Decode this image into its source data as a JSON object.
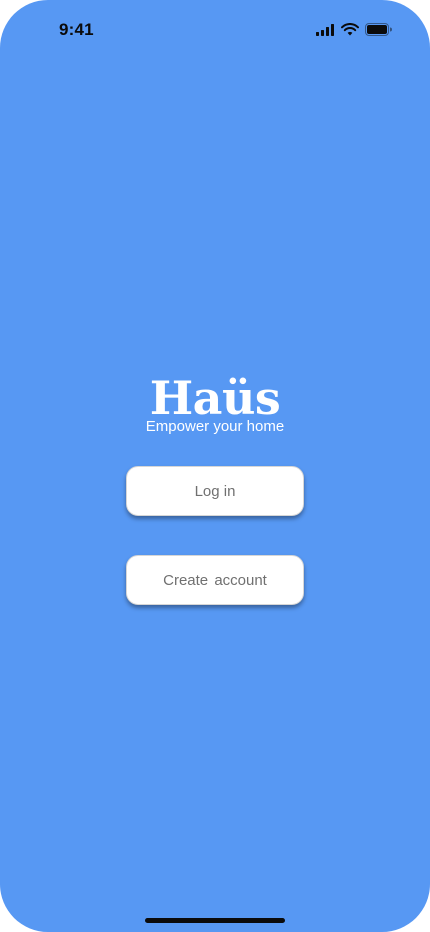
{
  "status_bar": {
    "time": "9:41",
    "icons": [
      "cellular-signal-icon",
      "wifi-icon",
      "battery-icon"
    ]
  },
  "brand": {
    "logo": "Haüs",
    "tagline": "Empower your home"
  },
  "actions": {
    "login_label": "Log in",
    "create_account_label": "Create  account"
  },
  "colors": {
    "background": "#5798f3",
    "button_background": "#ffffff",
    "button_text": "#707070",
    "text_on_background": "#ffffff"
  }
}
